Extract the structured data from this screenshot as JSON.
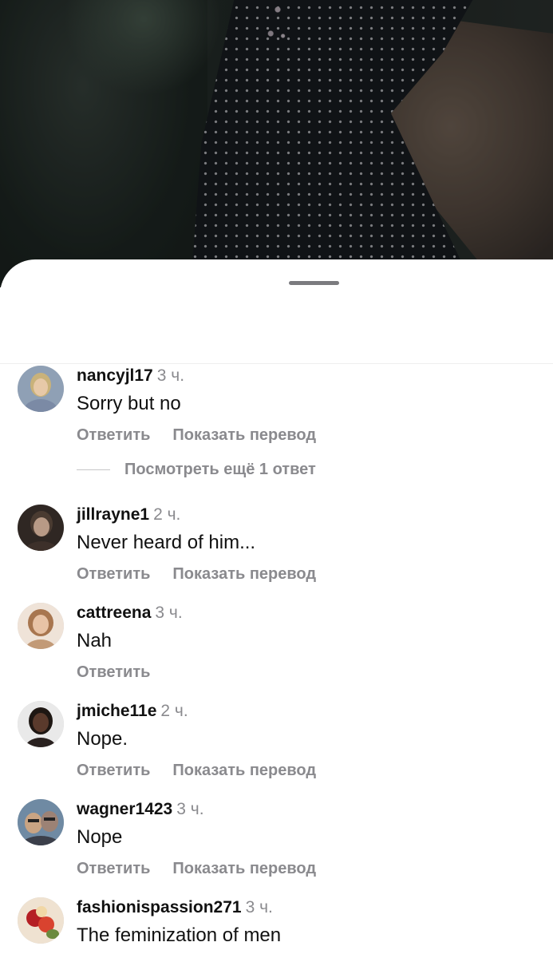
{
  "comments": [
    {
      "username": "nancyjl17",
      "time": "3 ч.",
      "text": "Sorry but no",
      "reply_label": "Ответить",
      "translate_label": "Показать перевод",
      "avatar_colors": [
        "#c9b27a",
        "#7b8aa5"
      ]
    },
    {
      "username": "jillrayne1",
      "time": "2 ч.",
      "text": "Never heard of him...",
      "reply_label": "Ответить",
      "translate_label": "Показать перевод",
      "avatar_colors": [
        "#b89a86",
        "#2f2723"
      ]
    },
    {
      "username": "cattreena",
      "time": "3 ч.",
      "text": "Nah",
      "reply_label": "Ответить",
      "avatar_colors": [
        "#c29a77",
        "#efe3d8"
      ]
    },
    {
      "username": "jmiche11e",
      "time": "2 ч.",
      "text": "Nope.",
      "reply_label": "Ответить",
      "translate_label": "Показать перевод",
      "avatar_colors": [
        "#5a3a2c",
        "#e9e9e9"
      ]
    },
    {
      "username": "wagner1423",
      "time": "3 ч.",
      "text": "Nope",
      "reply_label": "Ответить",
      "translate_label": "Показать перевод",
      "avatar_colors": [
        "#9c8275",
        "#6f8aa3"
      ]
    },
    {
      "username": "fashionispassion271",
      "time": "3 ч.",
      "text": "The feminization of men",
      "avatar_colors": [
        "#b51f24",
        "#efe2d1"
      ]
    }
  ],
  "more_replies_label": "Посмотреть ещё 1 ответ",
  "colors": {
    "muted_text": "#8a8a8e",
    "primary_text": "#111111",
    "handle": "#7b7b7f"
  }
}
